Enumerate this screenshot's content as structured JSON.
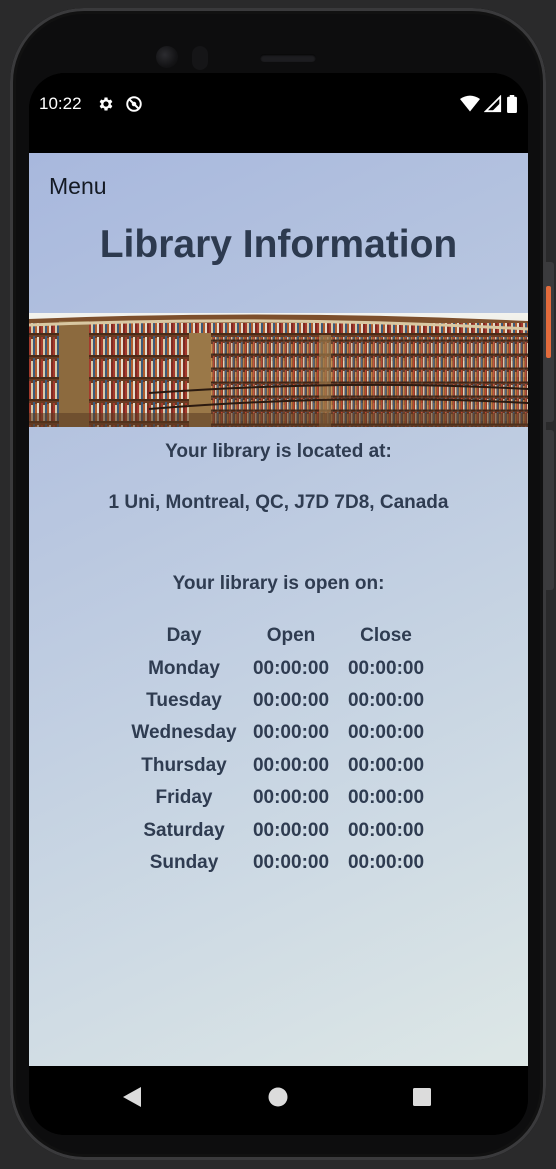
{
  "statusbar": {
    "time": "10:22",
    "left_icons": [
      "gear-icon",
      "do-not-disturb-icon"
    ],
    "right_icons": [
      "wifi-icon",
      "signal-icon",
      "battery-icon"
    ]
  },
  "app": {
    "menu_label": "Menu",
    "title": "Library Information",
    "banner_image": "library-bookshelves-image",
    "located_label": "Your library is located at:",
    "address": "1 Uni, Montreal, QC, J7D 7D8, Canada",
    "open_label": "Your library is open on:",
    "hours": {
      "headers": [
        "Day",
        "Open",
        "Close"
      ],
      "rows": [
        {
          "day": "Monday",
          "open": "00:00:00",
          "close": "00:00:00"
        },
        {
          "day": "Tuesday",
          "open": "00:00:00",
          "close": "00:00:00"
        },
        {
          "day": "Wednesday",
          "open": "00:00:00",
          "close": "00:00:00"
        },
        {
          "day": "Thursday",
          "open": "00:00:00",
          "close": "00:00:00"
        },
        {
          "day": "Friday",
          "open": "00:00:00",
          "close": "00:00:00"
        },
        {
          "day": "Saturday",
          "open": "00:00:00",
          "close": "00:00:00"
        },
        {
          "day": "Sunday",
          "open": "00:00:00",
          "close": "00:00:00"
        }
      ]
    }
  },
  "navbar": {
    "buttons": [
      "back-icon",
      "home-icon",
      "recents-icon"
    ]
  },
  "colors": {
    "text_dark": "#2d3a4f",
    "menu_text": "#141a24",
    "gradient_start": "#a8b8dd",
    "gradient_end": "#dde7e6",
    "side_button_accent": "#e46c3c"
  }
}
